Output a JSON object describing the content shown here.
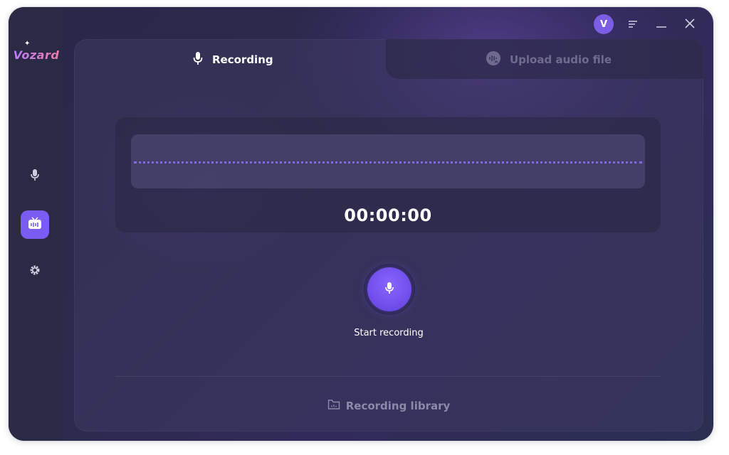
{
  "app": {
    "name": "Vozard"
  },
  "titlebar": {
    "avatar_letter": "V",
    "icons": [
      "menu-icon",
      "minimize-icon",
      "close-icon"
    ]
  },
  "sidebar": {
    "items": [
      {
        "icon": "microphone-icon",
        "active": false
      },
      {
        "icon": "voice-changer-icon",
        "active": true
      },
      {
        "icon": "settings-icon",
        "active": false
      }
    ]
  },
  "tabs": [
    {
      "label": "Recording",
      "icon": "microphone-icon",
      "active": true
    },
    {
      "label": "Upload audio file",
      "icon": "upload-audio-icon",
      "active": false
    }
  ],
  "recorder": {
    "timer": "00:00:00",
    "start_label": "Start recording"
  },
  "footer": {
    "library_label": "Recording library"
  },
  "colors": {
    "accent": "#7a5cf0",
    "background": "#2c2a4e",
    "text_primary": "#ffffff",
    "text_muted": "#8c88aa"
  }
}
